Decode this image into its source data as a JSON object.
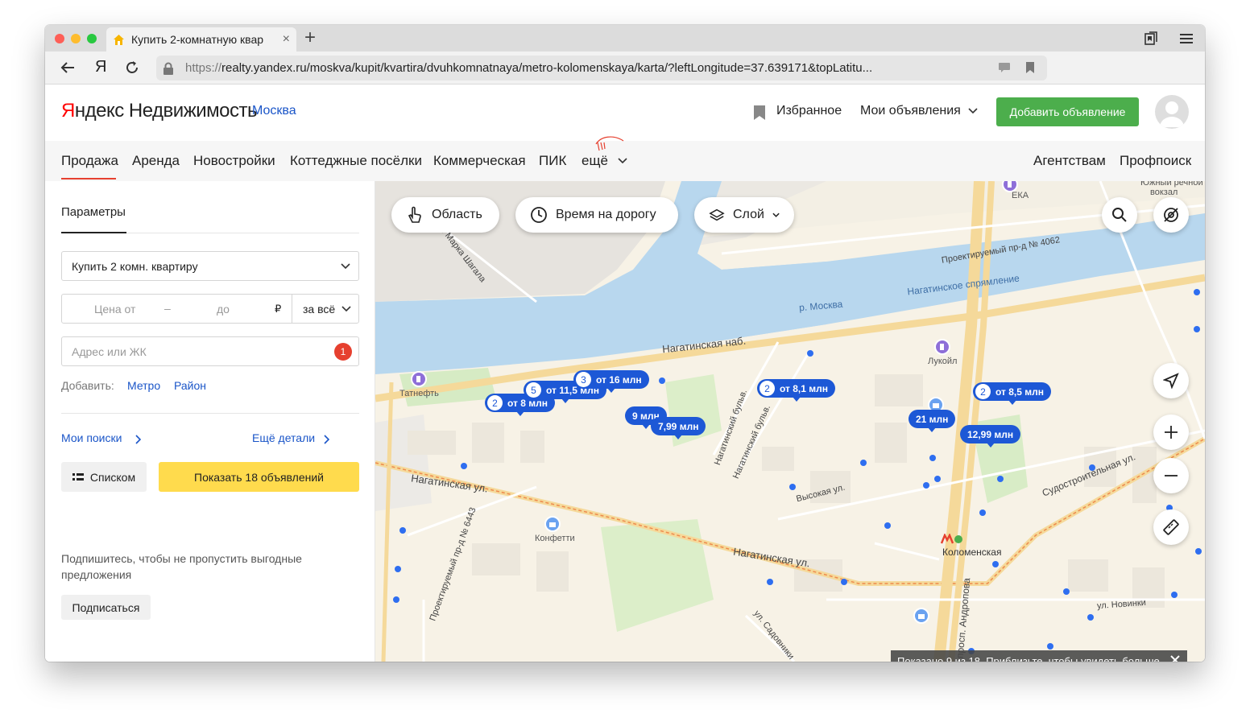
{
  "browser": {
    "tab_title": "Купить 2-комнатную квар",
    "nav_ya": "Я",
    "url_proto": "https://",
    "url_rest": "realty.yandex.ru/moskva/kupit/kvartira/dvuhkomnatnaya/metro-kolomenskaya/karta/?leftLongitude=37.639171&topLatitu..."
  },
  "header": {
    "logo_ya": "Я",
    "logo_rest": "ндекс",
    "logo_product": "Недвижимость",
    "city": "Москва",
    "favorites": "Избранное",
    "my_ads": "Мои объявления",
    "add_ad": "Добавить объявление"
  },
  "menu": {
    "items": [
      "Продажа",
      "Аренда",
      "Новостройки",
      "Коттеджные посёлки",
      "Коммерческая",
      "ПИК",
      "ещё"
    ],
    "right": [
      "Агентствам",
      "Профпоиск"
    ],
    "active": "Продажа"
  },
  "sidebar": {
    "params_tab": "Параметры",
    "deal_type": "Купить 2 комн. квартиру",
    "price_from": "Цена от",
    "price_dash": "–",
    "price_to": "до",
    "currency": "₽",
    "price_per": "за всё",
    "address_placeholder": "Адрес или ЖК",
    "address_badge": "1",
    "add_label": "Добавить:",
    "add_metro": "Метро",
    "add_district": "Район",
    "my_searches": "Мои поиски",
    "more_details": "Ещё детали",
    "list_button": "Списком",
    "show_button": "Показать 18 объявлений",
    "subscribe_text": "Подпишитесь, чтобы не пропустить выгодные предложения",
    "subscribe_button": "Подписаться"
  },
  "map": {
    "controls": {
      "area": "Область",
      "commute": "Время на дорогу",
      "layer": "Слой"
    },
    "markers": [
      {
        "count": "2",
        "label": "от 8 млн"
      },
      {
        "count": "5",
        "label": "от 11,5 млн"
      },
      {
        "count": "3",
        "label": "от 16 млн"
      },
      {
        "count": "",
        "label": "9 млн"
      },
      {
        "count": "",
        "label": "7,99 млн"
      },
      {
        "count": "2",
        "label": "от 8,1 млн"
      },
      {
        "count": "",
        "label": "21 млн"
      },
      {
        "count": "2",
        "label": "от 8,5 млн"
      },
      {
        "count": "",
        "label": "12,99 млн"
      }
    ],
    "labels": {
      "river": "р. Москва",
      "nagatino_channel": "Нагатинское спрямление",
      "embankment": "Нагатинская наб.",
      "street1": "Нагатинская ул.",
      "street2": "Нагатинская ул.",
      "street_vys": "Высокая ул.",
      "street_sudo": "Судостроительная ул.",
      "street_novinki": "ул. Новинки",
      "street_sad": "ул. Садовники",
      "prosp": "просп. Андропова",
      "proj4062": "Проектируемый пр-д № 4062",
      "proj6443": "Проектируемый пр-д № 6443",
      "marka": "ул. Марка Шагала",
      "bulvar1": "Нагатинский бульв.",
      "bulvar2": "Нагатинский бульв.",
      "tatneft": "Татнефть",
      "lukoil": "Лукойл",
      "konfetti": "Конфетти",
      "kolomenskaya": "Коломенская",
      "eka": "ЕКА",
      "vokzal1": "Южный речной",
      "vokzal2": "вокзал"
    },
    "notice": "Показано 9 из 18. Приблизьте, чтобы увидеть больше."
  }
}
